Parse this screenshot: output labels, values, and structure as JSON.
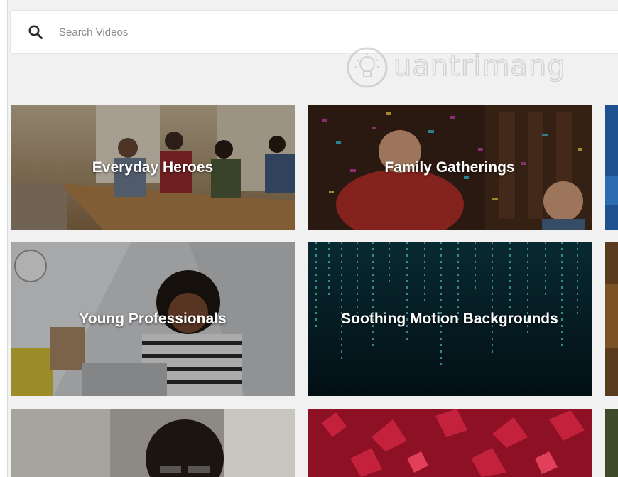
{
  "search": {
    "placeholder": "Search Videos",
    "value": "",
    "icon": "search-icon"
  },
  "watermark": {
    "text": "uantrimang",
    "icon": "lightbulb-icon"
  },
  "categories": [
    {
      "label": "Everyday Heroes"
    },
    {
      "label": "Family Gatherings"
    },
    {
      "label": ""
    },
    {
      "label": "Young Professionals"
    },
    {
      "label": "Soothing Motion Backgrounds"
    },
    {
      "label": ""
    },
    {
      "label": ""
    },
    {
      "label": ""
    },
    {
      "label": ""
    }
  ],
  "colors": {
    "background": "#f1f1f1",
    "search_bg": "#ffffff",
    "placeholder": "#8a8a8a",
    "label": "#ffffff"
  }
}
